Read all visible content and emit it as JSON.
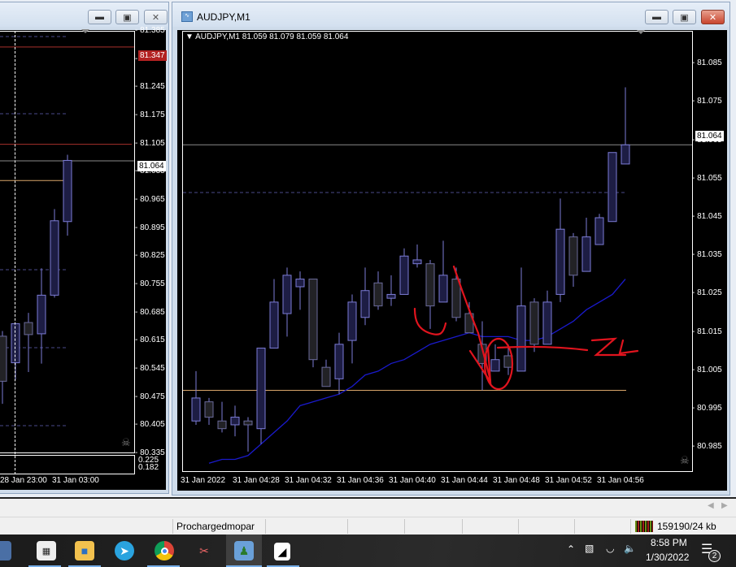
{
  "left_window": {
    "buttons": {
      "minimize": "minimize",
      "restore": "restore",
      "close": "close"
    },
    "price_ticks": [
      "81.385",
      "81.315",
      "81.245",
      "81.175",
      "81.105",
      "81.035",
      "80.965",
      "80.895",
      "80.825",
      "80.755",
      "80.685",
      "80.615",
      "80.545",
      "80.475",
      "80.405",
      "80.335"
    ],
    "price_range": [
      80.335,
      81.385
    ],
    "labels": {
      "red_line": "81.347",
      "bid": "81.064"
    },
    "lines": {
      "red_upper": 81.347,
      "red_lower": 81.105,
      "bid": 81.064,
      "orange": 81.015
    },
    "subwindow_values": [
      "0.225",
      "0.182"
    ],
    "time_labels": [
      "28 Jan 23:00",
      "31 Jan 03:00"
    ],
    "candles": [
      [
        80.628,
        80.641,
        80.46,
        80.516
      ],
      [
        80.562,
        80.659,
        80.52,
        80.659
      ],
      [
        80.662,
        80.686,
        80.539,
        80.632
      ],
      [
        80.634,
        80.797,
        80.56,
        80.73
      ],
      [
        80.73,
        80.944,
        80.724,
        80.915
      ],
      [
        80.913,
        81.079,
        80.878,
        81.065
      ]
    ]
  },
  "right_window": {
    "title": "AUDJPY,M1",
    "buttons": {
      "minimize": "minimize",
      "restore": "restore",
      "close": "close"
    },
    "header": "AUDJPY,M1  81.059 81.079 81.059 81.064",
    "price_ticks": [
      "81.085",
      "81.075",
      "81.065",
      "81.055",
      "81.045",
      "81.035",
      "81.025",
      "81.015",
      "81.005",
      "80.995",
      "80.985"
    ],
    "price_range": [
      80.9785,
      81.0935
    ],
    "bid_label": "81.064",
    "lines": {
      "bid": 81.064,
      "dashed": 81.05,
      "orange": 81.0
    },
    "time_labels": [
      "31 Jan 2022",
      "31 Jan 04:28",
      "31 Jan 04:32",
      "31 Jan 04:36",
      "31 Jan 04:40",
      "31 Jan 04:44",
      "31 Jan 04:48",
      "31 Jan 04:52",
      "31 Jan 04:56"
    ],
    "candles": [
      [
        80.992,
        81.005,
        80.991,
        80.998
      ],
      [
        80.997,
        80.998,
        80.991,
        80.993
      ],
      [
        80.992,
        80.997,
        80.989,
        80.99
      ],
      [
        80.991,
        80.996,
        80.988,
        80.993
      ],
      [
        80.992,
        80.993,
        80.984,
        80.991
      ],
      [
        80.99,
        81.011,
        80.986,
        81.011
      ],
      [
        81.011,
        81.029,
        81.011,
        81.023
      ],
      [
        81.02,
        81.032,
        81.014,
        81.03
      ],
      [
        81.027,
        81.031,
        81.021,
        81.029
      ],
      [
        81.029,
        81.029,
        81.006,
        81.008
      ],
      [
        81.006,
        81.008,
        81.001,
        81.001
      ],
      [
        81.003,
        81.015,
        80.999,
        81.012
      ],
      [
        81.013,
        81.025,
        81.007,
        81.023
      ],
      [
        81.019,
        81.032,
        81.017,
        81.026
      ],
      [
        81.028,
        81.031,
        81.021,
        81.022
      ],
      [
        81.024,
        81.03,
        81.022,
        81.025
      ],
      [
        81.025,
        81.037,
        81.025,
        81.035
      ],
      [
        81.033,
        81.038,
        81.032,
        81.034
      ],
      [
        81.033,
        81.034,
        81.016,
        81.022
      ],
      [
        81.023,
        81.039,
        81.023,
        81.03
      ],
      [
        81.029,
        81.032,
        81.018,
        81.019
      ],
      [
        81.02,
        81.023,
        81.015,
        81.015
      ],
      [
        81.012,
        81.018,
        81.0,
        81.007
      ],
      [
        81.005,
        81.012,
        81.005,
        81.008
      ],
      [
        81.009,
        81.012,
        81.004,
        81.006
      ],
      [
        81.005,
        81.032,
        81.005,
        81.022
      ],
      [
        81.023,
        81.024,
        81.01,
        81.012
      ],
      [
        81.012,
        81.026,
        81.012,
        81.023
      ],
      [
        81.025,
        81.05,
        81.023,
        81.042
      ],
      [
        81.04,
        81.041,
        81.027,
        81.03
      ],
      [
        81.031,
        81.045,
        81.031,
        81.04
      ],
      [
        81.038,
        81.046,
        81.038,
        81.045
      ],
      [
        81.044,
        81.062,
        81.044,
        81.062
      ],
      [
        81.059,
        81.079,
        81.059,
        81.064
      ]
    ],
    "moving_average": [
      null,
      80.981,
      80.982,
      80.982,
      80.983,
      80.986,
      80.989,
      80.992,
      80.996,
      80.997,
      80.998,
      80.999,
      81.001,
      81.004,
      81.005,
      81.007,
      81.008,
      81.01,
      81.012,
      81.013,
      81.014,
      81.015,
      81.014,
      81.014,
      81.014,
      81.013,
      81.013,
      81.014,
      81.016,
      81.018,
      81.021,
      81.023,
      81.025,
      81.029
    ],
    "annotation_text": "ZL"
  },
  "colors": {
    "bull_fill": "#1d1d44",
    "bear_fill": "#222226",
    "candle_border": "#7c7cd6",
    "ma": "#1a1acc",
    "orange": "#d9a66a",
    "red": "#e0141e",
    "bid_line": "#8a8a8a",
    "red_line": "#a8302c"
  },
  "status_bar": {
    "profile": "Prochargedmopar",
    "traffic": "159190/24 kb"
  },
  "taskbar": {
    "apps": [
      "calculator-icon",
      "file-explorer-icon",
      "telegram-icon",
      "chrome-icon",
      "snipping-tool-icon",
      "metatrader-icon",
      "notepad-icon"
    ],
    "time": "8:58 PM",
    "date": "1/30/2022",
    "notifications": "2"
  }
}
